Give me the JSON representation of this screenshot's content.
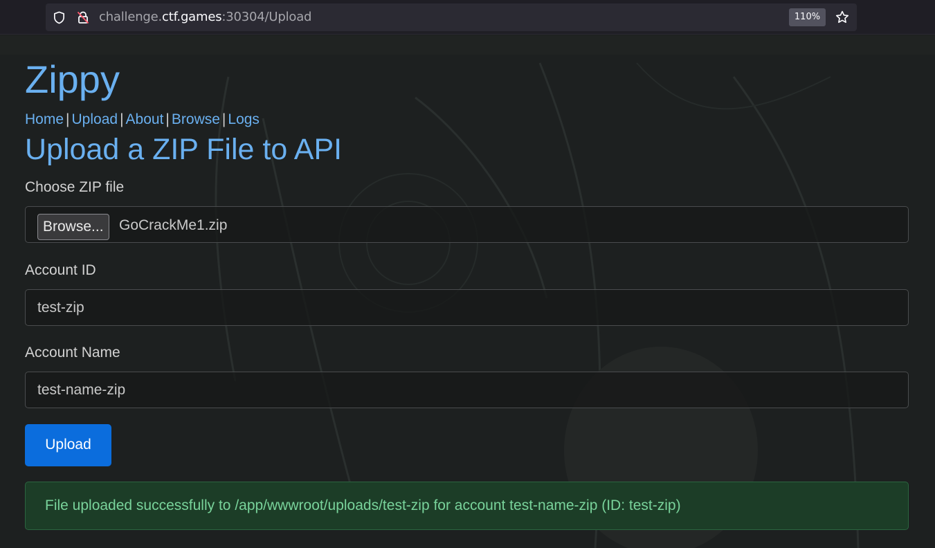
{
  "browser": {
    "url_host_prefix": "challenge.",
    "url_host": "ctf.games",
    "url_path": ":30304/Upload",
    "zoom": "110%"
  },
  "site": {
    "title": "Zippy",
    "nav": [
      {
        "label": "Home"
      },
      {
        "label": "Upload"
      },
      {
        "label": "About"
      },
      {
        "label": "Browse"
      },
      {
        "label": "Logs"
      }
    ],
    "nav_separator": "|"
  },
  "form": {
    "heading": "Upload a ZIP File to API",
    "file_label": "Choose ZIP file",
    "browse_label": "Browse...",
    "file_name": "GoCrackMe1.zip",
    "account_id_label": "Account ID",
    "account_id_value": "test-zip",
    "account_name_label": "Account Name",
    "account_name_value": "test-name-zip",
    "submit_label": "Upload"
  },
  "alert": {
    "message": "File uploaded successfully to /app/wwwroot/uploads/test-zip for account test-name-zip (ID: test-zip)"
  },
  "colors": {
    "link": "#6ab0f0",
    "primary_button": "#0b6ddd",
    "success_bg": "#1c3d27",
    "success_text": "#79d39b"
  }
}
